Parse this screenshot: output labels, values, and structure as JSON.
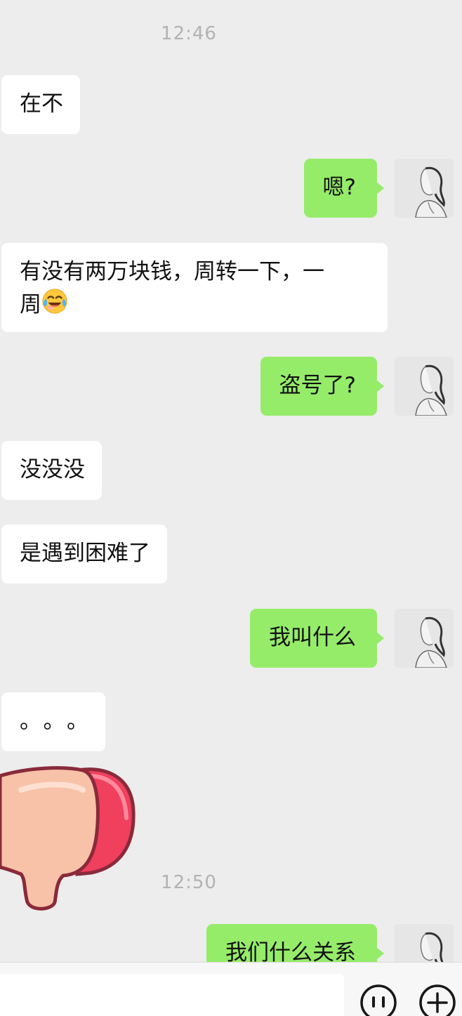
{
  "timestamps": [
    "12:46",
    "12:50"
  ],
  "messages": [
    {
      "side": "left",
      "text": "在不"
    },
    {
      "side": "right",
      "text": "嗯?"
    },
    {
      "side": "left",
      "line1": "有没有两万块钱，周转一下，一",
      "line2": "周",
      "emoji": "face-with-tears-of-joy-icon"
    },
    {
      "side": "right",
      "text": "盗号了?"
    },
    {
      "side": "left",
      "text": "没没没"
    },
    {
      "side": "left",
      "text": "是遇到困难了"
    },
    {
      "side": "right",
      "text": "我叫什么"
    },
    {
      "side": "left",
      "text": "。。。"
    },
    {
      "side": "left",
      "sticker": "thumbs-down-sticker"
    },
    {
      "side": "right",
      "text": "我们什么关系"
    }
  ],
  "input": {
    "placeholder": "",
    "value": ""
  },
  "icons": {
    "voice": "voice-icon",
    "emoji": "emoji-icon"
  },
  "colors": {
    "background": "#ededed",
    "sent_bubble": "#95ec69",
    "received_bubble": "#ffffff",
    "timestamp": "#b2b2b2"
  }
}
